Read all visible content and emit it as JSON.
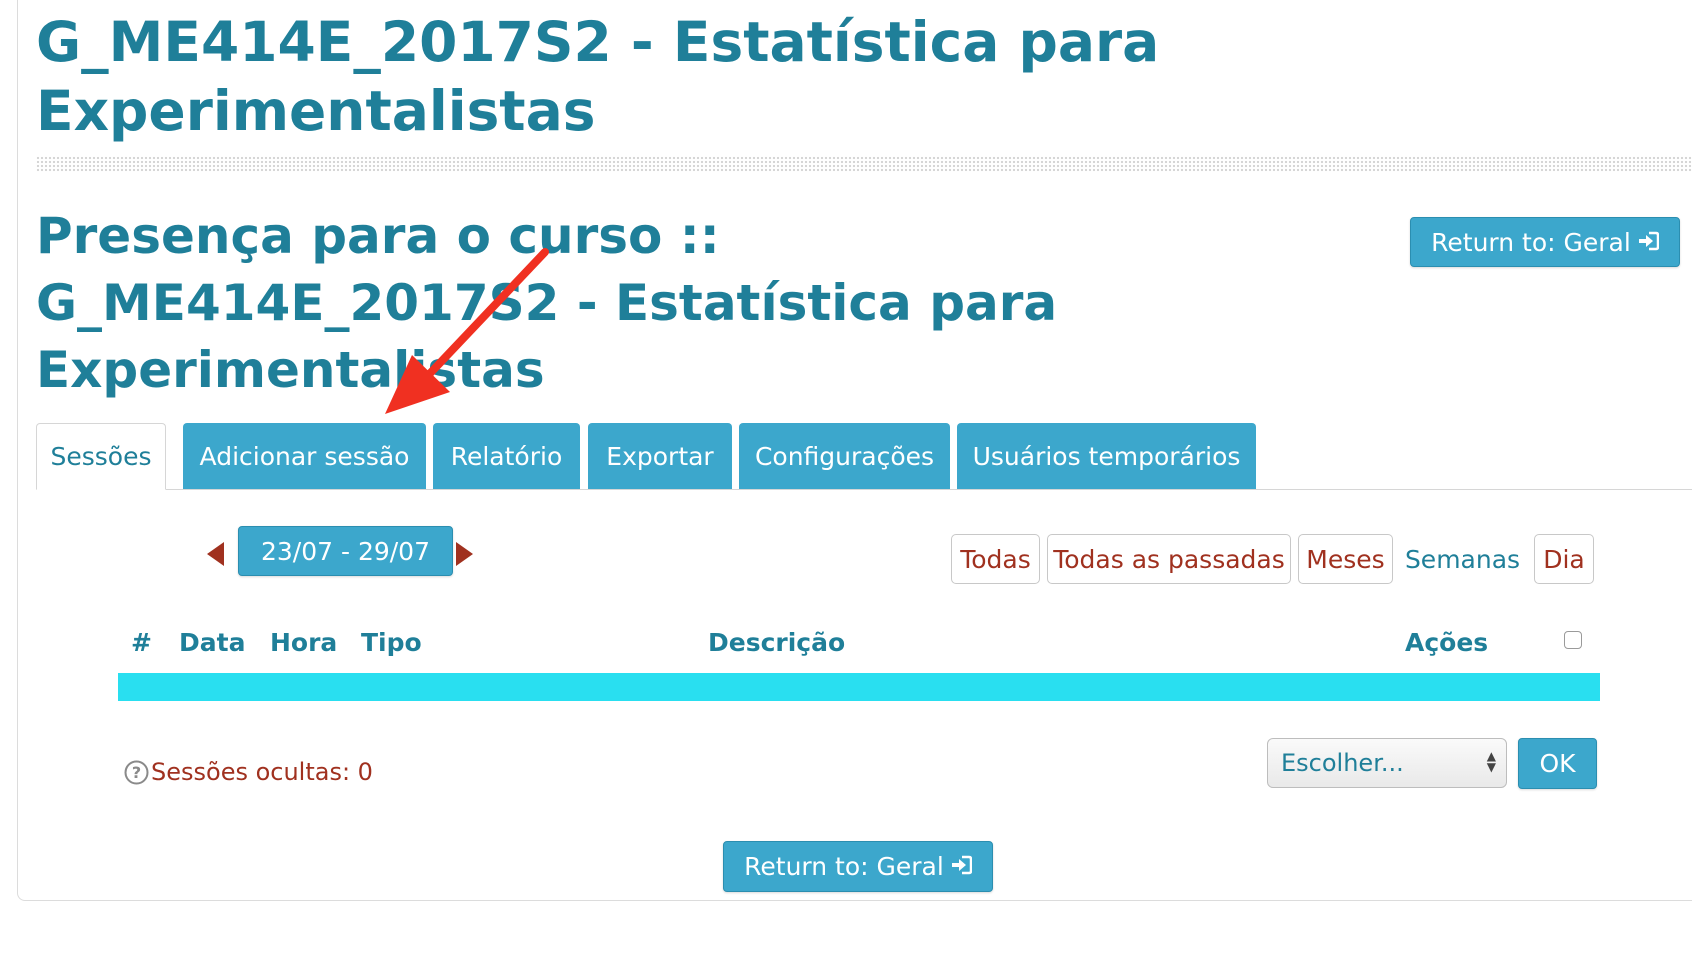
{
  "course": {
    "title": "G_ME414E_2017S2 - Estatística para Experimentalistas"
  },
  "attendance": {
    "title": "Presença para o curso :: G_ME414E_2017S2 - Estatística para Experimentalistas"
  },
  "return_button": {
    "label": "Return to: Geral",
    "icon": "login-icon"
  },
  "tabs": [
    {
      "label": "Sessões",
      "active": true
    },
    {
      "label": "Adicionar sessão",
      "active": false
    },
    {
      "label": "Relatório",
      "active": false
    },
    {
      "label": "Exportar",
      "active": false
    },
    {
      "label": "Configurações",
      "active": false
    },
    {
      "label": "Usuários temporários",
      "active": false
    }
  ],
  "date_nav": {
    "range": "23/07 - 29/07"
  },
  "view_filters": [
    {
      "label": "Todas",
      "current": false
    },
    {
      "label": "Todas as passadas",
      "current": false
    },
    {
      "label": "Meses",
      "current": false
    },
    {
      "label": "Semanas",
      "current": true
    },
    {
      "label": "Dia",
      "current": false
    }
  ],
  "table": {
    "headers": [
      "#",
      "Data",
      "Hora",
      "Tipo",
      "Descrição",
      "Ações"
    ],
    "rows": []
  },
  "footer": {
    "hidden_sessions": "Sessões ocultas: 0",
    "select_value": "Escolher...",
    "ok_label": "OK"
  },
  "colors": {
    "heading": "#1f7f99",
    "button": "#3ca7cc",
    "accent_red": "#a0311f",
    "table_bar": "#29dff0",
    "annotation_arrow": "#f03021"
  }
}
